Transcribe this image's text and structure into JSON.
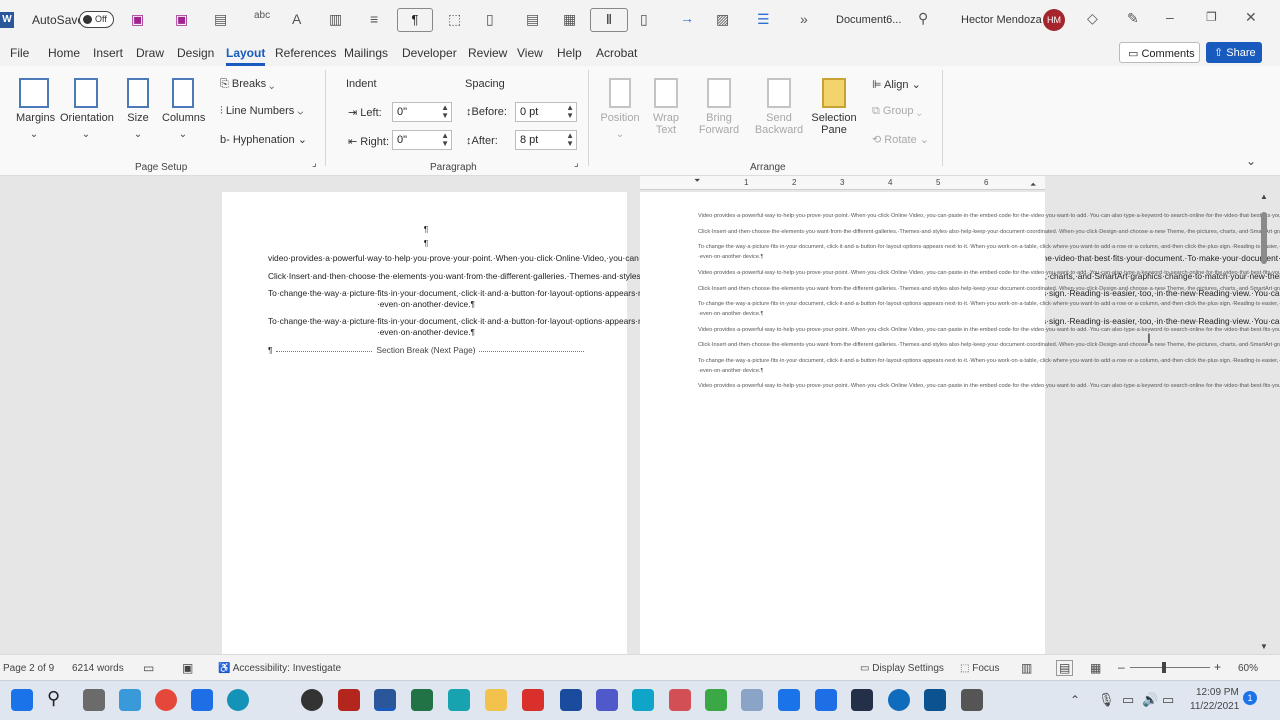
{
  "titlebar": {
    "autosave_label": "AutoSave",
    "autosave_state": "Off",
    "doc_title": "Document6...",
    "user_name": "Hector Mendoza",
    "user_initials": "HM"
  },
  "menu": {
    "tabs": [
      "File",
      "Home",
      "Insert",
      "Draw",
      "Design",
      "Layout",
      "References",
      "Mailings",
      "Developer",
      "Review",
      "View",
      "Help",
      "Acrobat"
    ],
    "active": "Layout",
    "comments_label": "Comments",
    "share_label": "Share"
  },
  "ribbon": {
    "page_setup": {
      "margins": "Margins",
      "orientation": "Orientation",
      "size": "Size",
      "columns": "Columns",
      "breaks": "Breaks",
      "line_numbers": "Line Numbers",
      "hyphenation": "Hyphenation",
      "group_label": "Page Setup"
    },
    "paragraph": {
      "indent_label": "Indent",
      "spacing_label": "Spacing",
      "left_label": "Left:",
      "left_value": "0\"",
      "right_label": "Right:",
      "right_value": "0\"",
      "before_label": "Before:",
      "before_value": "0 pt",
      "after_label": "After:",
      "after_value": "8 pt",
      "group_label": "Paragraph"
    },
    "arrange": {
      "position": "Position",
      "wrap_text_1": "Wrap",
      "wrap_text_2": "Text",
      "bring_forward_1": "Bring",
      "bring_forward_2": "Forward",
      "send_backward_1": "Send",
      "send_backward_2": "Backward",
      "selection_pane_1": "Selection",
      "selection_pane_2": "Pane",
      "align": "Align",
      "group": "Group",
      "rotate": "Rotate",
      "group_label": "Arrange"
    }
  },
  "ruler": {
    "numbers": [
      "1",
      "2",
      "3",
      "4",
      "5",
      "6"
    ]
  },
  "doc_left": {
    "pilcrow_1": "¶",
    "pilcrow_2": "¶",
    "paragraphs": [
      "video·provides·a·powerful·way·to·help·you·prove·your·point.·When·you·click·Online·Video,·you·can·paste·in·the·embed·code·for·the·video·you·want·to·add.·You·can·also·type·a·keyword·to·search·online·for·the·video·that·best·fits·your·document.·To·make·your·document·look·professionally·produced,·Word·provides·header,·footer,·cover·page,·and·text·box·designs·that·complement·each·other.·For·example,·you·can·add·a·matching·cover·page,·header,·and·sidebar.¶",
      "Click·Insert·and·then·choose·the·elements·you·want·from·the·different·galleries.·Themes·and·styles·also·help·keep·your·document·coordinated.·When·you·click·Design·and·choose·a·new·Theme,·the·pictures,·charts,·and·SmartArt·graphics·change·to·match·your·new·theme.·When·you·apply·styles,·your·headings·change·to·match·the·new·theme.·Save·time·in·Word·with·new·buttons·that·show·up·where·you·need·them.¶",
      "To·change·the·way·a·picture·fits·in·your·document,·click·it·and·a·button·for·layout·options·appears·next·to·it.·When·you·work·on·a·table,·click·where·you·want·to·add·a·row·or·a·column,·and·then·click·the·plus·sign.·Reading·is·easier,·too,·in·the·new·Reading·view.·You·can·collapse·parts·of·the·document·and·focus·on·the·text·you·want.·If·you·need·to·stop·reading·before·you·reach·the·end,·Word·remembers·where·you·left·off·-·even·on·another·device.¶",
      "To·change·the·way·a·picture·fits·in·your·document,·click·it·and·a·button·for·layout·options·appears·next·to·it.·When·you·work·on·a·table,·click·where·you·want·to·add·a·row·or·a·column,·and·then·click·the·plus·sign.·Reading·is·easier,·too,·in·the·new·Reading·view.·You·can·collapse·parts·of·the·document·and·focus·on·the·text·you·want.·If·you·need·to·stop·reading·before·you·reach·the·end,·Word·remembers·where·you·left·off·-·even·on·another·device.¶"
    ],
    "section_break": "Section Break (Next Page)",
    "section_pilcrow": "¶"
  },
  "doc_right": {
    "paragraphs": [
      "Video·provides·a·powerful·way·to·help·you·prove·your·point.·When·you·click·Online·Video,·you·can·paste·in·the·embed·code·for·the·video·you·want·to·add.·You·can·also·type·a·keyword·to·search·online·for·the·video·that·best·fits·your·document.·To·make·your·document·look·professionally·produced,·Word·provides·header,·footer,·cover·page,·and·text·box·designs·that·complement·each·other.·For·example,·you·can·add·a·matching·cover·page,·header,·and·sidebar.¶",
      "Click·Insert·and·then·choose·the·elements·you·want·from·the·different·galleries.·Themes·and·styles·also·help·keep·your·document·coordinated.·When·you·click·Design·and·choose·a·new·Theme,·the·pictures,·charts,·and·SmartArt·graphics·change·to·match·your·new·theme.·When·you·apply·styles,·your·headings·change·to·match·the·new·theme.·Save·time·in·Word·with·new·buttons·that·show·up·where·you·need·them.¶",
      "To·change·the·way·a·picture·fits·in·your·document,·click·it·and·a·button·for·layout·options·appears·next·to·it.·When·you·work·on·a·table,·click·where·you·want·to·add·a·row·or·a·column,·and·then·click·the·plus·sign.·Reading·is·easier,·too,·in·the·new·Reading·view.·You·can·collapse·parts·of·the·document·and·focus·on·the·text·you·want.·If·you·need·to·stop·reading·before·you·reach·the·end,·Word·remembers·where·you·left·off·-·even·on·another·device.¶",
      "Video·provides·a·powerful·way·to·help·you·prove·your·point.·When·you·click·Online·Video,·you·can·paste·in·the·embed·code·for·the·video·you·want·to·add.·You·can·also·type·a·keyword·to·search·online·for·the·video·that·best·fits·your·document.·To·make·your·document·look·professionally·produced,·Word·provides·header,·footer,·cover·page,·and·text·box·designs·that·complement·each·other.·For·example,·you·can·add·a·matching·cover·page,·header,·and·sidebar.¶",
      "Click·Insert·and·then·choose·the·elements·you·want·from·the·different·galleries.·Themes·and·styles·also·help·keep·your·document·coordinated.·When·you·click·Design·and·choose·a·new·Theme,·the·pictures,·charts,·and·SmartArt·graphics·change·to·match·your·new·theme.·When·you·apply·styles,·your·headings·change·to·match·the·new·theme.·Save·time·in·Word·with·new·buttons·that·show·up·where·you·need·them.¶",
      "To·change·the·way·a·picture·fits·in·your·document,·click·it·and·a·button·for·layout·options·appears·next·to·it.·When·you·work·on·a·table,·click·where·you·want·to·add·a·row·or·a·column,·and·then·click·the·plus·sign.·Reading·is·easier,·too,·in·the·new·Reading·view.·You·can·collapse·parts·of·the·document·and·focus·on·the·text·you·want.·If·you·need·to·stop·reading·before·you·reach·the·end,·Word·remembers·where·you·left·off·-·even·on·another·device.¶",
      "Video·provides·a·powerful·way·to·help·you·prove·your·point.·When·you·click·Online·Video,·you·can·paste·in·the·embed·code·for·the·video·you·want·to·add.·You·can·also·type·a·keyword·to·search·online·for·the·video·that·best·fits·your·document.·To·make·your·document·look·professionally·produced,·Word·provides·header,·footer,·cover·page,·and·text·box·designs·that·complement·each·other.·For·example,·you·can·add·a·matching·cover·page,·header,·and·sidebar.¶",
      "Click·Insert·and·then·choose·the·elements·you·want·from·the·different·galleries.·Themes·and·styles·also·help·keep·your·document·coordinated.·When·you·click·Design·and·choose·a·new·Theme,·the·pictures,·charts,·and·SmartArt·graphics·change·to·match·your·new·theme.·When·you·apply·styles,·your·headings·change·to·match·the·new·theme.·Save·time·in·Word·with·new·buttons·that·show·up·where·you·need·them.¶",
      "To·change·the·way·a·picture·fits·in·your·document,·click·it·and·a·button·for·layout·options·appears·next·to·it.·When·you·work·on·a·table,·click·where·you·want·to·add·a·row·or·a·column,·and·then·click·the·plus·sign.·Reading·is·easier,·too,·in·the·new·Reading·view.·You·can·collapse·parts·of·the·document·and·focus·on·the·text·you·want.·If·you·need·to·stop·reading·before·you·reach·the·end,·Word·remembers·where·you·left·off·-·even·on·another·device.¶",
      "Video·provides·a·powerful·way·to·help·you·prove·your·point.·When·you·click·Online·Video,·you·can·paste·in·the·embed·code·for·the·video·you·want·to·add.·You·can·also·type·a·keyword·to·search·online·for·the·video·that·best·fits·your·document."
    ]
  },
  "status": {
    "page": "Page 2 of 9",
    "words": "6214 words",
    "accessibility": "Accessibility: Investigate",
    "display_settings": "Display Settings",
    "focus": "Focus",
    "zoom": "60%",
    "zoom_fraction": 0.42
  },
  "taskbar": {
    "time": "12:09 PM",
    "date": "11/22/2021",
    "notif_count": "1"
  },
  "colors": {
    "accent": "#185abd",
    "word_blue": "#2b579a",
    "avatar": "#a4262c"
  }
}
